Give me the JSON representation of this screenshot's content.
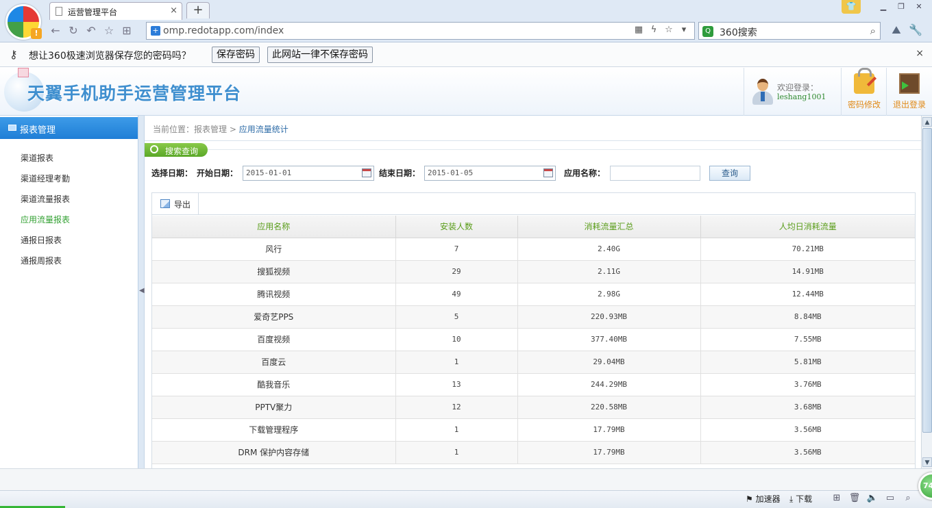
{
  "browser": {
    "tab_title": "运营管理平台",
    "tab_close": "×",
    "new_tab": "+",
    "url": "omp.redotapp.com/index",
    "search_engine": "360搜索",
    "password_prompt": {
      "message": "想让360极速浏览器保存您的密码吗？",
      "save_button": "保存密码",
      "never_button": "此网站一律不保存密码",
      "close": "×"
    }
  },
  "header": {
    "title": "天翼手机助手运营管理平台",
    "welcome": "欢迎登录：",
    "username": "leshang1001",
    "change_password": "密码修改",
    "logout": "退出登录"
  },
  "sidebar": {
    "title": "报表管理",
    "items": [
      {
        "label": "渠道报表"
      },
      {
        "label": "渠道经理考勤"
      },
      {
        "label": "渠道流量报表"
      },
      {
        "label": "应用流量报表"
      },
      {
        "label": "通报日报表"
      },
      {
        "label": "通报周报表"
      }
    ],
    "active_index": 3
  },
  "breadcrumb": {
    "prefix": "当前位置：报表管理",
    "separator": ">",
    "current": "应用流量统计"
  },
  "search": {
    "section_title": "搜索查询",
    "date_label": "选择日期：",
    "start_label": "开始日期：",
    "start_value": "2015-01-01",
    "end_label": "结束日期：",
    "end_value": "2015-01-05",
    "app_name_label": "应用名称：",
    "app_name_value": "",
    "query_button": "查询"
  },
  "grid": {
    "export_label": "导出",
    "columns": [
      "应用名称",
      "安装人数",
      "消耗流量汇总",
      "人均日消耗流量"
    ],
    "rows": [
      [
        "风行",
        "7",
        "2.40G",
        "70.21MB"
      ],
      [
        "搜狐视频",
        "29",
        "2.11G",
        "14.91MB"
      ],
      [
        "腾讯视频",
        "49",
        "2.98G",
        "12.44MB"
      ],
      [
        "爱奇艺PPS",
        "5",
        "220.93MB",
        "8.84MB"
      ],
      [
        "百度视频",
        "10",
        "377.40MB",
        "7.55MB"
      ],
      [
        "百度云",
        "1",
        "29.04MB",
        "5.81MB"
      ],
      [
        "酷我音乐",
        "13",
        "244.29MB",
        "3.76MB"
      ],
      [
        "PPTV聚力",
        "12",
        "220.58MB",
        "3.68MB"
      ],
      [
        "下载管理程序",
        "1",
        "17.79MB",
        "3.56MB"
      ],
      [
        "DRM 保护内容存储",
        "1",
        "17.79MB",
        "3.56MB"
      ]
    ]
  },
  "statusbar": {
    "accelerator": "加速器",
    "download": "下载",
    "speed_badge": "74"
  }
}
